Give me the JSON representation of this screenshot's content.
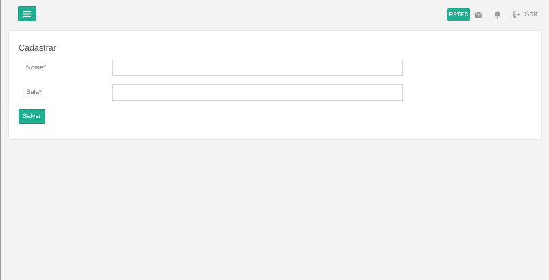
{
  "topbar": {
    "menu_icon": "hamburger-icon",
    "badge_label": "RPTEC",
    "mail_icon": "envelope-icon",
    "bell_icon": "bell-icon",
    "logout_icon": "sign-out-icon",
    "logout_label": "Sair"
  },
  "form": {
    "title": "Cadastrar",
    "fields": [
      {
        "label": "Nome*",
        "value": "",
        "placeholder": ""
      },
      {
        "label": "Sala*",
        "value": "",
        "placeholder": ""
      }
    ],
    "submit_label": "Salvar"
  },
  "colors": {
    "accent": "#1fae8f",
    "background": "#f3f3f3",
    "card": "#ffffff",
    "icon": "#9a9a9a"
  }
}
